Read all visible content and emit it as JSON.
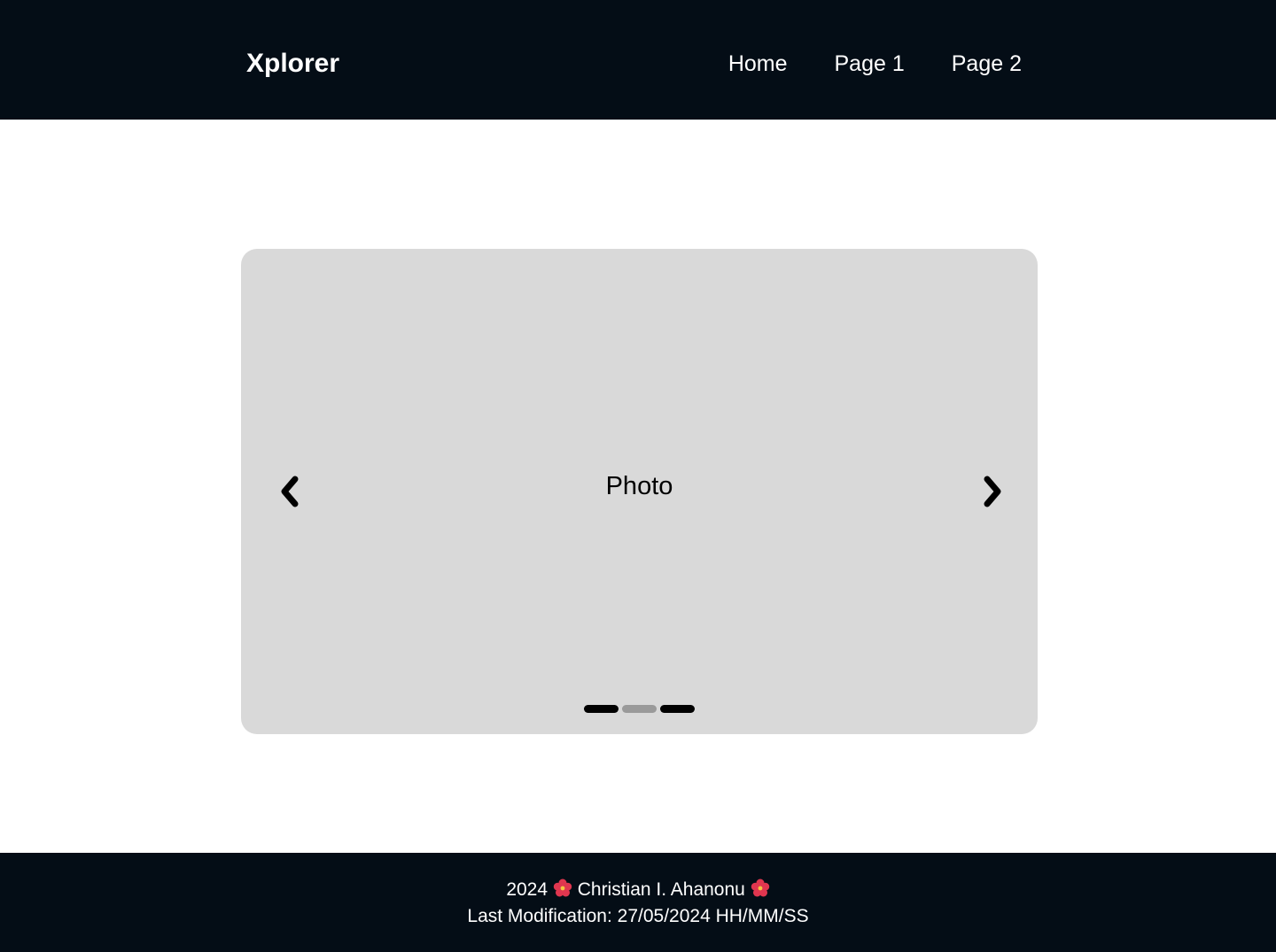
{
  "header": {
    "brand": "Xplorer",
    "nav": [
      {
        "label": "Home"
      },
      {
        "label": "Page 1"
      },
      {
        "label": "Page 2"
      }
    ]
  },
  "carousel": {
    "slide_label": "Photo",
    "prev_icon": "chevron-left-icon",
    "next_icon": "chevron-right-icon",
    "slide_count": 3,
    "active_index": 1
  },
  "footer": {
    "year": "2024",
    "author": "Christian I. Ahanonu",
    "flower_icon": "hibiscus-icon",
    "last_modification": "Last Modification: 27/05/2024 HH/MM/SS"
  },
  "colors": {
    "header_bg": "#040d16",
    "footer_bg": "#040d16",
    "carousel_bg": "#d9d9d9",
    "dot_default": "#000000",
    "dot_active": "#9a9a9a"
  }
}
